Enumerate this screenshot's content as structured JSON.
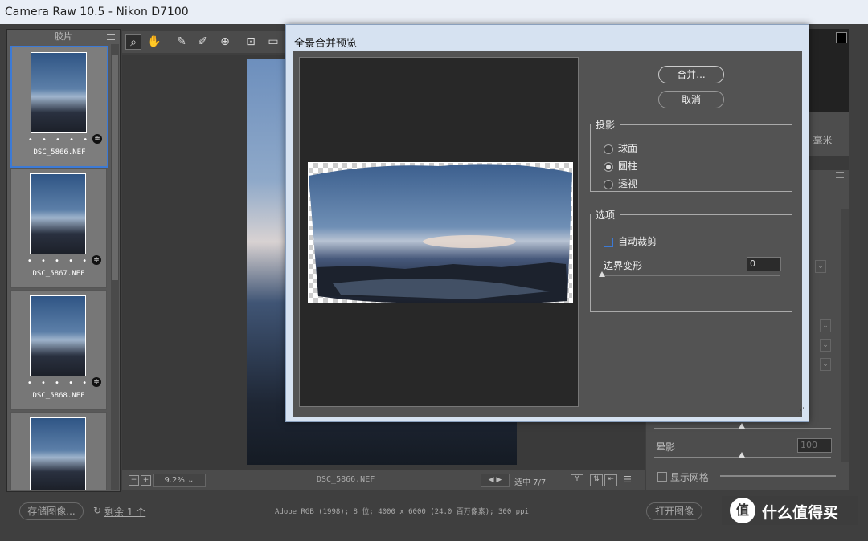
{
  "window": {
    "title": "Camera Raw 10.5 -  Nikon D7100"
  },
  "filmstrip": {
    "header": "胶片",
    "items": [
      {
        "name": "DSC_5866.NEF",
        "dots": "• • • • •",
        "selected": true
      },
      {
        "name": "DSC_5867.NEF",
        "dots": "• • • • •",
        "selected": false
      },
      {
        "name": "DSC_5868.NEF",
        "dots": "• • • • •",
        "selected": false
      },
      {
        "name": "",
        "dots": "",
        "selected": false
      }
    ]
  },
  "toolbar": {
    "tools": [
      "zoom-icon",
      "hand-icon",
      "white-balance-icon",
      "color-sampler-icon",
      "target-adjust-icon",
      "crop-icon",
      "straighten-icon"
    ]
  },
  "canvas": {
    "zoom": "9.2%",
    "filename": "DSC_5866.NEF",
    "selection": "选中 7/7"
  },
  "right_panel": {
    "unit_text": "8 毫米",
    "halo_label": "晕影",
    "halo_value": "100",
    "grid_label": "显示网格"
  },
  "bottom": {
    "save_label": "存储图像...",
    "remaining": "剩余 1 个",
    "workflow": "Adobe RGB (1998); 8 位; 4000 x 6000 (24.0 百万像素); 300 ppi",
    "open_label": "打开图像",
    "brand": "什么值得买"
  },
  "dialog": {
    "title": "全景合并预览",
    "merge_label": "合并...",
    "cancel_label": "取消",
    "projection": {
      "legend": "投影",
      "options": [
        "球面",
        "圆柱",
        "透视"
      ],
      "selected": 1
    },
    "options": {
      "legend": "选项",
      "auto_crop": "自动裁剪",
      "auto_crop_checked": false,
      "boundary_label": "边界变形",
      "boundary_value": "0"
    }
  },
  "colors": {
    "accent": "#3c7ad6",
    "dialog_frame": "#d6e2f1",
    "panel": "#535353"
  }
}
